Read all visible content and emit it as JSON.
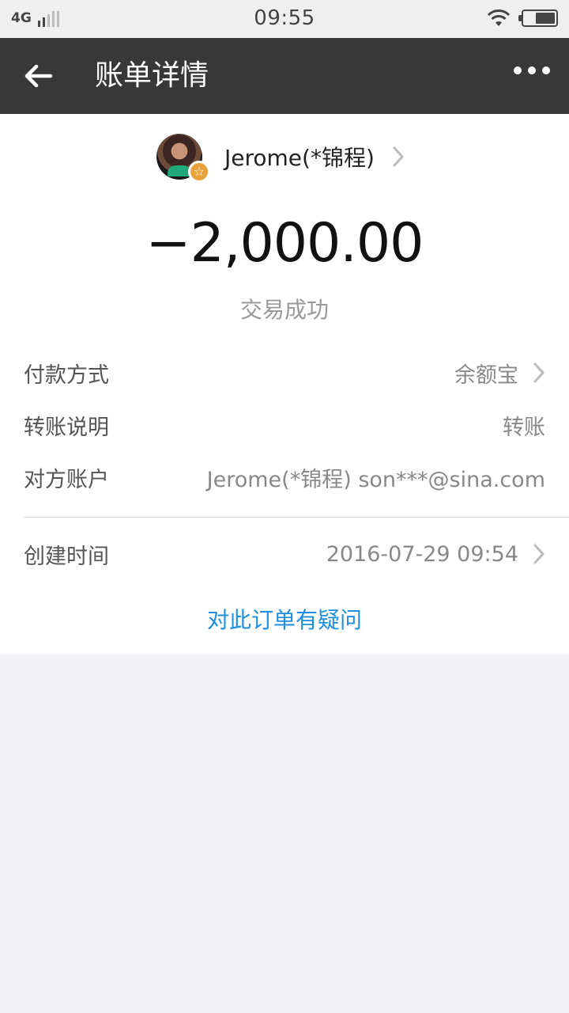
{
  "status_bar": {
    "network": "4G",
    "time": "09:55",
    "signal_level": 2,
    "battery_level": 0.55
  },
  "header": {
    "title": "账单详情",
    "back_icon": "back-arrow-icon",
    "more_icon": "more-dots-icon"
  },
  "bill": {
    "contact_name": "Jerome(*锦程)",
    "amount": "−2,000.00",
    "status": "交易成功",
    "details": [
      {
        "label": "付款方式",
        "value": "余额宝",
        "has_chevron": true
      },
      {
        "label": "转账说明",
        "value": "转账",
        "has_chevron": false
      },
      {
        "label": "对方账户",
        "value": "Jerome(*锦程) son***@sina.com",
        "has_chevron": false
      },
      {
        "label": "创建时间",
        "value": "2016-07-29 09:54",
        "has_chevron": true
      }
    ],
    "question_link": "对此订单有疑问"
  },
  "colors": {
    "header_bg": "#383838",
    "link": "#1e8fe0",
    "page_bg": "#f3f2f7",
    "badge": "#e8a23b"
  }
}
